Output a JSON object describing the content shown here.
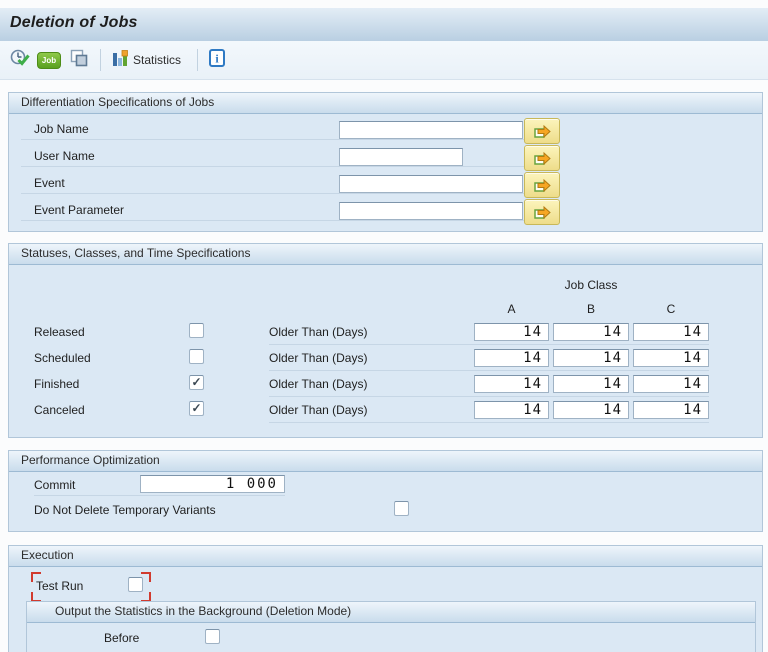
{
  "title": "Deletion of Jobs",
  "toolbar": {
    "job_badge_label": "Job",
    "statistics_label": "Statistics",
    "icons": [
      "execute-icon",
      "job-icon",
      "copy-icon",
      "statistics-icon",
      "info-icon"
    ]
  },
  "sections": {
    "differentiation": {
      "header": "Differentiation Specifications of Jobs",
      "fields": [
        {
          "label": "Job Name",
          "value": ""
        },
        {
          "label": "User Name",
          "value": ""
        },
        {
          "label": "Event",
          "value": ""
        },
        {
          "label": "Event Parameter",
          "value": ""
        }
      ]
    },
    "statuses": {
      "header": "Statuses, Classes, and Time Specifications",
      "job_class_label": "Job Class",
      "columns": [
        "A",
        "B",
        "C"
      ],
      "older_than_label": "Older Than (Days)",
      "rows": [
        {
          "label": "Released",
          "checked": false,
          "values": [
            "14",
            "14",
            "14"
          ]
        },
        {
          "label": "Scheduled",
          "checked": false,
          "values": [
            "14",
            "14",
            "14"
          ]
        },
        {
          "label": "Finished",
          "checked": true,
          "values": [
            "14",
            "14",
            "14"
          ]
        },
        {
          "label": "Canceled",
          "checked": true,
          "values": [
            "14",
            "14",
            "14"
          ]
        }
      ]
    },
    "performance": {
      "header": "Performance Optimization",
      "commit_label": "Commit",
      "commit_value": "1 000",
      "variants_label": "Do Not Delete Temporary Variants",
      "variants_checked": false
    },
    "execution": {
      "header": "Execution",
      "test_run_label": "Test Run",
      "test_run_checked": false,
      "subsection": {
        "header": "Output the Statistics in the Background (Deletion Mode)",
        "before_label": "Before",
        "before_checked": false
      }
    }
  },
  "colors": {
    "panel_bg": "#dbe8f4",
    "header_gradient_top": "#eef5fb",
    "header_gradient_bottom": "#c9dcec",
    "multi_select_button": "#eedd8a",
    "focus_bracket_red": "#d13a2e",
    "job_badge_green": "#58a01e"
  }
}
